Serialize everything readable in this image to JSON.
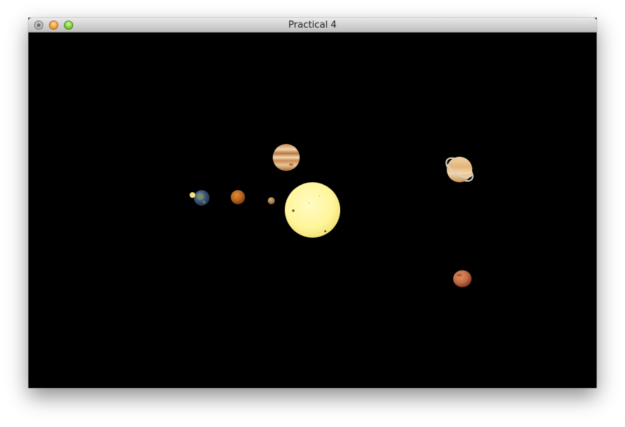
{
  "window": {
    "title": "Practical 4"
  },
  "window_controls": [
    {
      "name": "close",
      "color": "#9a9a9a"
    },
    {
      "name": "minimize",
      "color": "#f2a03a"
    },
    {
      "name": "zoom",
      "color": "#7fcf3a"
    }
  ],
  "scene": {
    "background": "#000000",
    "bodies": [
      {
        "name": "sun",
        "color": "#fff59a"
      },
      {
        "name": "jupiter",
        "color": "#d8a56c"
      },
      {
        "name": "saturn",
        "color": "#e3bc84"
      },
      {
        "name": "earth",
        "color": "#3d5a7a"
      },
      {
        "name": "moon",
        "color": "#f4e17a"
      },
      {
        "name": "mars-inner",
        "color": "#b8621f"
      },
      {
        "name": "mercury",
        "color": "#a8804f"
      },
      {
        "name": "red-planet",
        "color": "#c26a43"
      }
    ]
  }
}
